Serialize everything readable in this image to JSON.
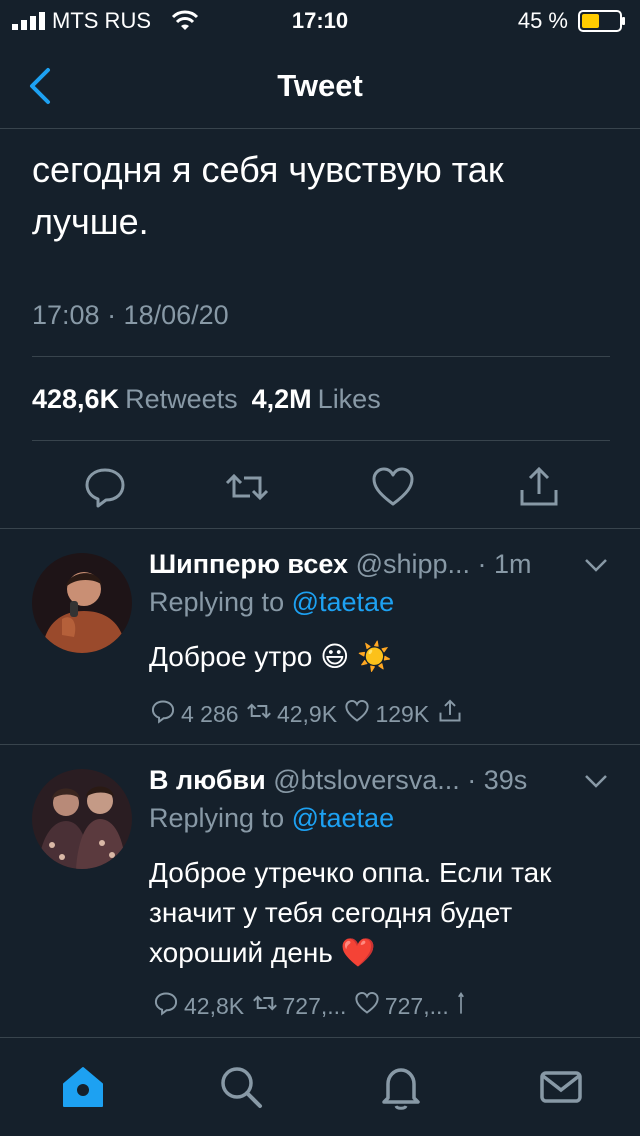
{
  "status": {
    "carrier": "MTS RUS",
    "time": "17:10",
    "battery": "45 %"
  },
  "nav": {
    "title": "Tweet"
  },
  "tweet": {
    "text": "сегодня я себя чувствую так лучше.",
    "meta": "17:08 · 18/06/20",
    "retweets_count": "428,6K",
    "retweets_label": "Retweets",
    "likes_count": "4,2M",
    "likes_label": "Likes"
  },
  "replies": [
    {
      "name": "Шипперю всех",
      "handle": "@shipp... · 1m",
      "replying_prefix": "Replying to",
      "mention": "@taetae",
      "text": "Доброе утро 😃 ☀️",
      "replies": "4 286",
      "retweets": "42,9K",
      "likes": "129K"
    },
    {
      "name": "В любви",
      "handle": "@btsloversva... · 39s",
      "replying_prefix": "Replying to",
      "mention": "@taetae",
      "text": "Доброе утречко оппа. Если так значит у тебя сегодня будет хороший день ❤️",
      "replies": "42,8K",
      "retweets": "727,...",
      "likes": "727,..."
    }
  ],
  "colors": {
    "background": "#15202b",
    "accent": "#1da1f2",
    "muted": "#8899a6",
    "divider": "#38444d"
  }
}
